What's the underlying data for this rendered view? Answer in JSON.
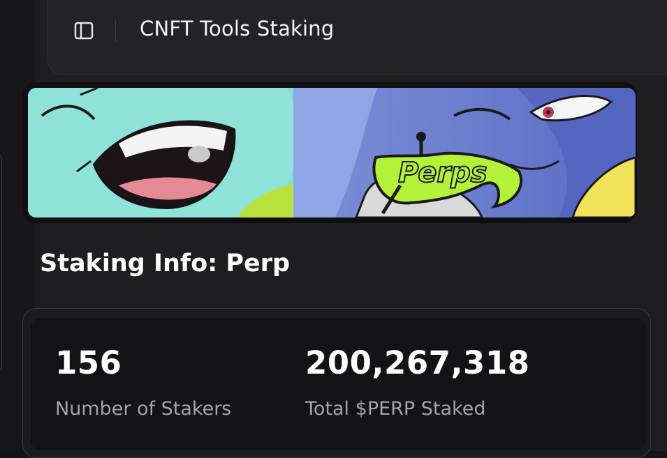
{
  "header": {
    "title": "CNFT Tools Staking",
    "toggle_icon": "sidebar-toggle-icon"
  },
  "banner": {
    "logo_text": "Perps"
  },
  "section": {
    "title": "Staking Info: Perp"
  },
  "stats": [
    {
      "value": "156",
      "label": "Number of Stakers"
    },
    {
      "value": "200,267,318",
      "label": "Total $PERP Staked"
    }
  ],
  "colors": {
    "background": "#151517",
    "card": "#131315",
    "muted_text": "#a4a4a8",
    "logo_green": "#b4f23a"
  }
}
